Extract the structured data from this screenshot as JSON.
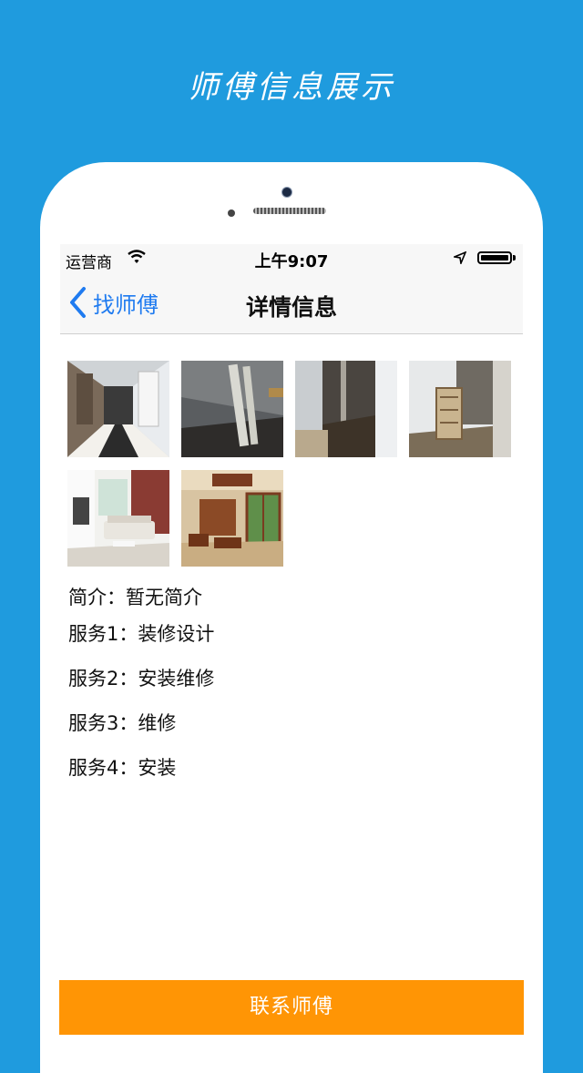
{
  "promo": {
    "title": "师傅信息展示"
  },
  "status_bar": {
    "carrier": "运营商",
    "time": "上午9:07",
    "wifi_icon": "wifi-icon",
    "location_icon": "location-arrow-icon",
    "battery_icon": "battery-icon"
  },
  "nav": {
    "back_label": "找师傅",
    "title": "详情信息",
    "back_icon": "chevron-left-icon"
  },
  "gallery": {
    "photos": [
      {
        "name": "photo-corridor"
      },
      {
        "name": "photo-construction-pipes"
      },
      {
        "name": "photo-narrow-hallway"
      },
      {
        "name": "photo-stairwell"
      },
      {
        "name": "photo-living-room"
      },
      {
        "name": "photo-classic-interior"
      }
    ]
  },
  "details": {
    "intro": "简介：暂无简介",
    "services": [
      "服务1：装修设计",
      "服务2：安装维修",
      "服务3：维修",
      "服务4：安装"
    ]
  },
  "contact_button": {
    "label": "联系师傅"
  },
  "colors": {
    "background": "#1f9bde",
    "accent": "#ff9505",
    "link": "#1f7bf0"
  }
}
